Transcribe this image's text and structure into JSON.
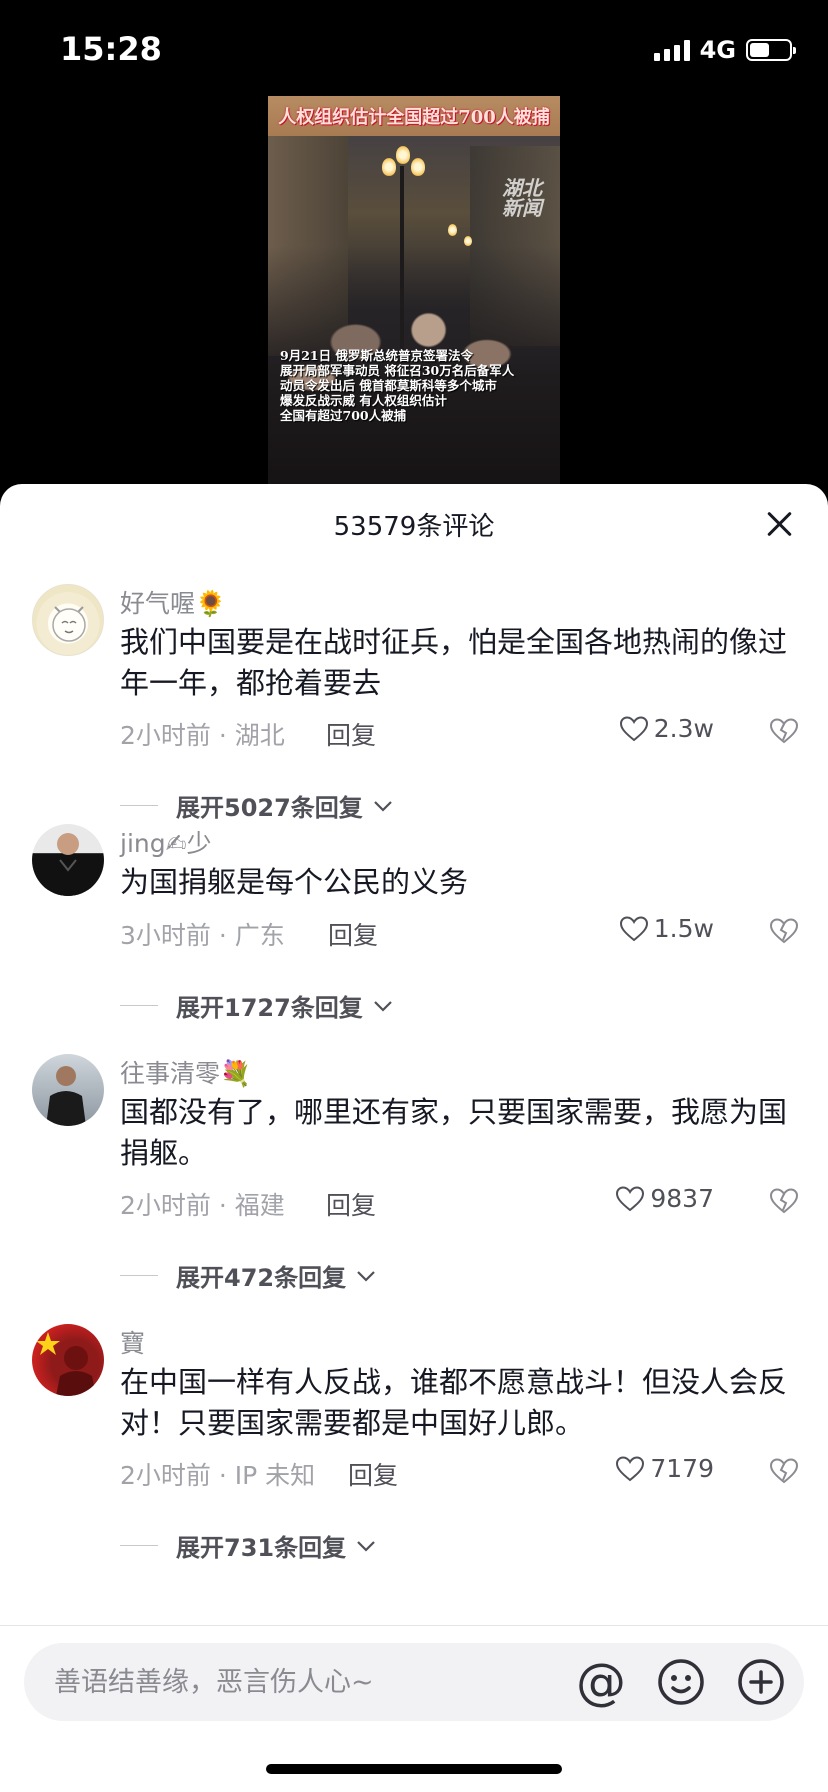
{
  "status_bar": {
    "time": "15:28",
    "network": "4G",
    "battery_level": 0.45
  },
  "video": {
    "banner": "人权组织估计全国超过700人被捕",
    "watermark_line1": "湖北",
    "watermark_line2": "新闻",
    "caption": "9月21日 俄罗斯总统普京签署法令\n展开局部军事动员 将征召30万名后备军人\n动员令发出后 俄首都莫斯科等多个城市\n爆发反战示威 有人权组织估计\n全国有超过700人被捕"
  },
  "comments_panel": {
    "title": "53579条评论",
    "comments": [
      {
        "username": "好气喔🌻",
        "text": "我们中国要是在战时征兵，怕是全国各地热闹的像过年一年，都抢着要去",
        "meta": "2小时前 · 湖北",
        "reply": "回复",
        "likes": "2.3w",
        "expand": "展开5027条回复"
      },
      {
        "username": "jing✍少",
        "text": "为国捐躯是每个公民的义务",
        "meta": "3小时前 · 广东",
        "reply": "回复",
        "likes": "1.5w",
        "expand": "展开1727条回复"
      },
      {
        "username": "往事清零💐",
        "text": "国都没有了，哪里还有家，只要国家需要，我愿为国捐躯。",
        "meta": "2小时前 · 福建",
        "reply": "回复",
        "likes": "9837",
        "expand": "展开472条回复"
      },
      {
        "username": "寶",
        "text": "在中国一样有人反战，谁都不愿意战斗！但没人会反对！只要国家需要都是中国好儿郎。",
        "meta": "2小时前 · IP 未知",
        "reply": "回复",
        "likes": "7179",
        "expand": "展开731条回复"
      }
    ]
  },
  "input_bar": {
    "placeholder": "善语结善缘，恶言伤人心~",
    "at_symbol": "@"
  }
}
